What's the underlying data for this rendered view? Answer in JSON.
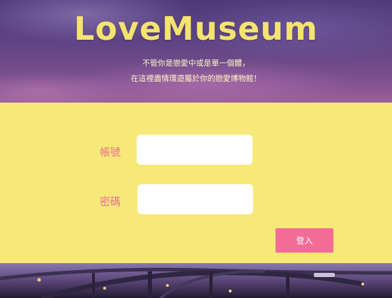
{
  "brand": {
    "title": "LoveMuseum",
    "tagline_line1": "不管你是戀愛中或是單一個體，",
    "tagline_line2": "在這裡盡情環遊屬於你的戀愛博物館！"
  },
  "login_form": {
    "account_label": "帳號",
    "password_label": "密碼",
    "account_value": "",
    "password_value": "",
    "submit_label": "登入"
  },
  "colors": {
    "brand_yellow": "#f4e36f",
    "form_background": "#f6e978",
    "label_pink": "#e8728f",
    "button_pink": "#f36c98"
  }
}
